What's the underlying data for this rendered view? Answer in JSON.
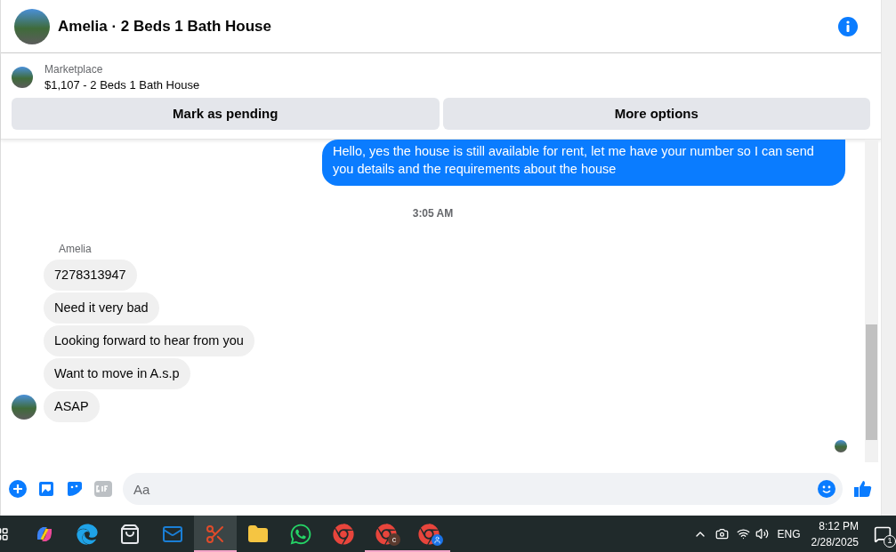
{
  "header": {
    "title": "Amelia · 2 Beds 1 Bath House"
  },
  "listing": {
    "source": "Marketplace",
    "title": "$1,107 - 2 Beds 1 Bath House"
  },
  "actions": [
    "Mark as pending",
    "More options"
  ],
  "outgoing": [
    "Hello, yes the house is still available for rent, let me have your number so I can send you details and the requirements about the house"
  ],
  "timestamp": "3:05 AM",
  "sender": "Amelia",
  "incoming": [
    {
      "text": "7278313947"
    },
    {
      "text": "Need it very bad"
    },
    {
      "text": "Looking forward to hear from you"
    },
    {
      "text": "Want to move in A.s.p"
    },
    {
      "text": "ASAP"
    }
  ],
  "composer": {
    "placeholder": "Aa"
  },
  "taskbar": {
    "apps": [
      {
        "kind": "copilot",
        "running": false,
        "selected": false
      },
      {
        "kind": "edge",
        "running": false,
        "selected": false
      },
      {
        "kind": "store",
        "running": false,
        "selected": false
      },
      {
        "kind": "outlook",
        "running": false,
        "selected": false
      },
      {
        "kind": "snip",
        "running": true,
        "selected": true
      },
      {
        "kind": "folder",
        "running": false,
        "selected": false
      },
      {
        "kind": "whatsapp",
        "running": false,
        "selected": false
      },
      {
        "kind": "chrome",
        "running": false,
        "selected": false
      },
      {
        "kind": "chrome",
        "badge": {
          "kind": "letter",
          "text": "c"
        },
        "running": true,
        "selected": false
      },
      {
        "kind": "chrome",
        "badge": {
          "kind": "person"
        },
        "running": true,
        "selected": false
      }
    ],
    "language": "ENG",
    "time": "8:12 PM",
    "date": "2/28/2025",
    "notifications": "1"
  }
}
